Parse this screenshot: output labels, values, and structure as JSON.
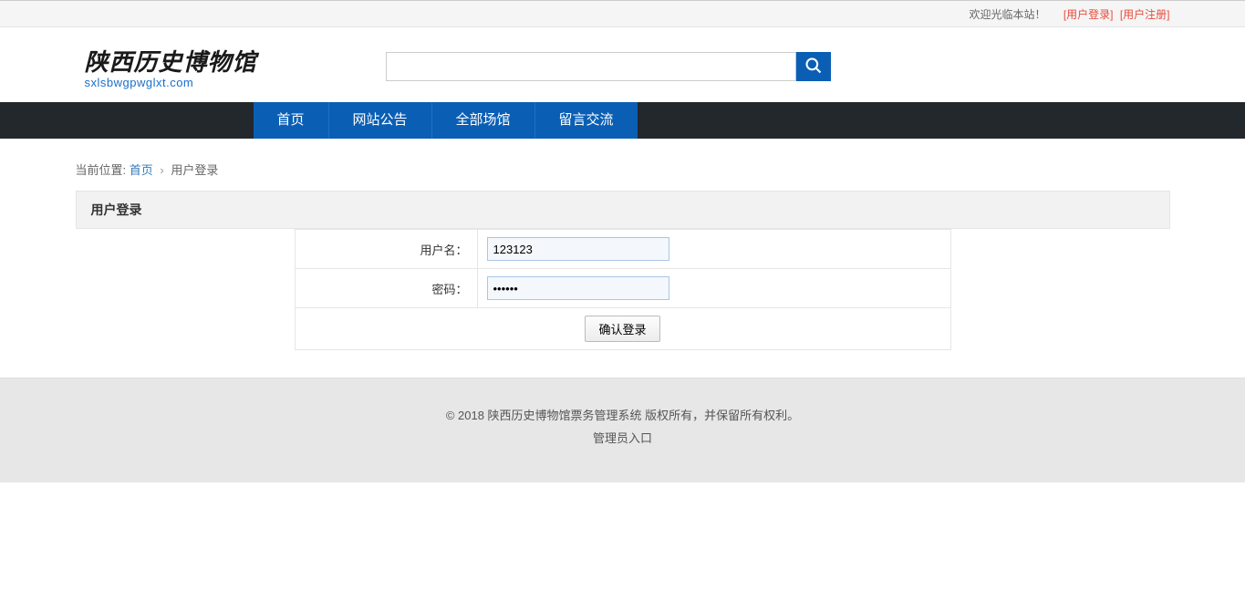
{
  "topbar": {
    "welcome": "欢迎光临本站！",
    "login_link": "[用户登录]",
    "register_link": "[用户注册]"
  },
  "logo": {
    "main": "陕西历史博物馆",
    "sub": "sxlsbwgpwglxt.com"
  },
  "search": {
    "placeholder": ""
  },
  "nav": {
    "items": [
      {
        "label": "首页"
      },
      {
        "label": "网站公告"
      },
      {
        "label": "全部场馆"
      },
      {
        "label": "留言交流"
      }
    ]
  },
  "breadcrumb": {
    "prefix": "当前位置:",
    "home": "首页",
    "sep": "›",
    "current": "用户登录"
  },
  "panel": {
    "title": "用户登录"
  },
  "form": {
    "username_label": "用户名：",
    "username_value": "123123",
    "password_label": "密码：",
    "password_value": "••••••",
    "submit_label": "确认登录"
  },
  "footer": {
    "copyright": "© 2018 陕西历史博物馆票务管理系统 版权所有，并保留所有权利。",
    "admin_link": "管理员入口"
  }
}
